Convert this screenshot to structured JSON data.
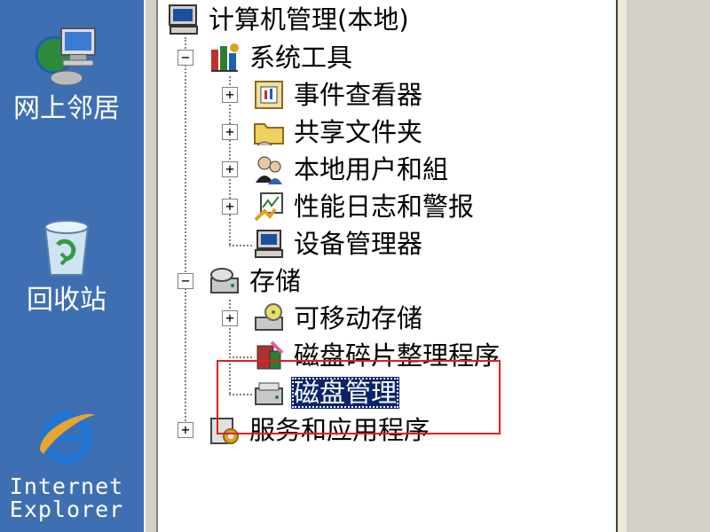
{
  "desktop": {
    "icons": [
      {
        "name": "network-places",
        "label": "网上邻居"
      },
      {
        "name": "recycle-bin",
        "label": "回收站"
      },
      {
        "name": "internet-explorer",
        "label": "Internet\nExplorer"
      }
    ]
  },
  "tree": {
    "root": "计算机管理(本地)",
    "system_tools": {
      "label": "系统工具",
      "children": [
        "事件查看器",
        "共享文件夹",
        "本地用户和組",
        "性能日志和警报",
        "设备管理器"
      ]
    },
    "storage": {
      "label": "存储",
      "children": [
        "可移动存储",
        "磁盘碎片整理程序",
        "磁盘管理"
      ]
    },
    "services": {
      "label": "服务和应用程序"
    },
    "selected": "磁盘管理"
  },
  "expander": {
    "expanded": "−",
    "collapsed": "+"
  },
  "colors": {
    "desktop": "#3f6fb3",
    "selection": "#0a246a",
    "highlight_box": "#e02020"
  }
}
